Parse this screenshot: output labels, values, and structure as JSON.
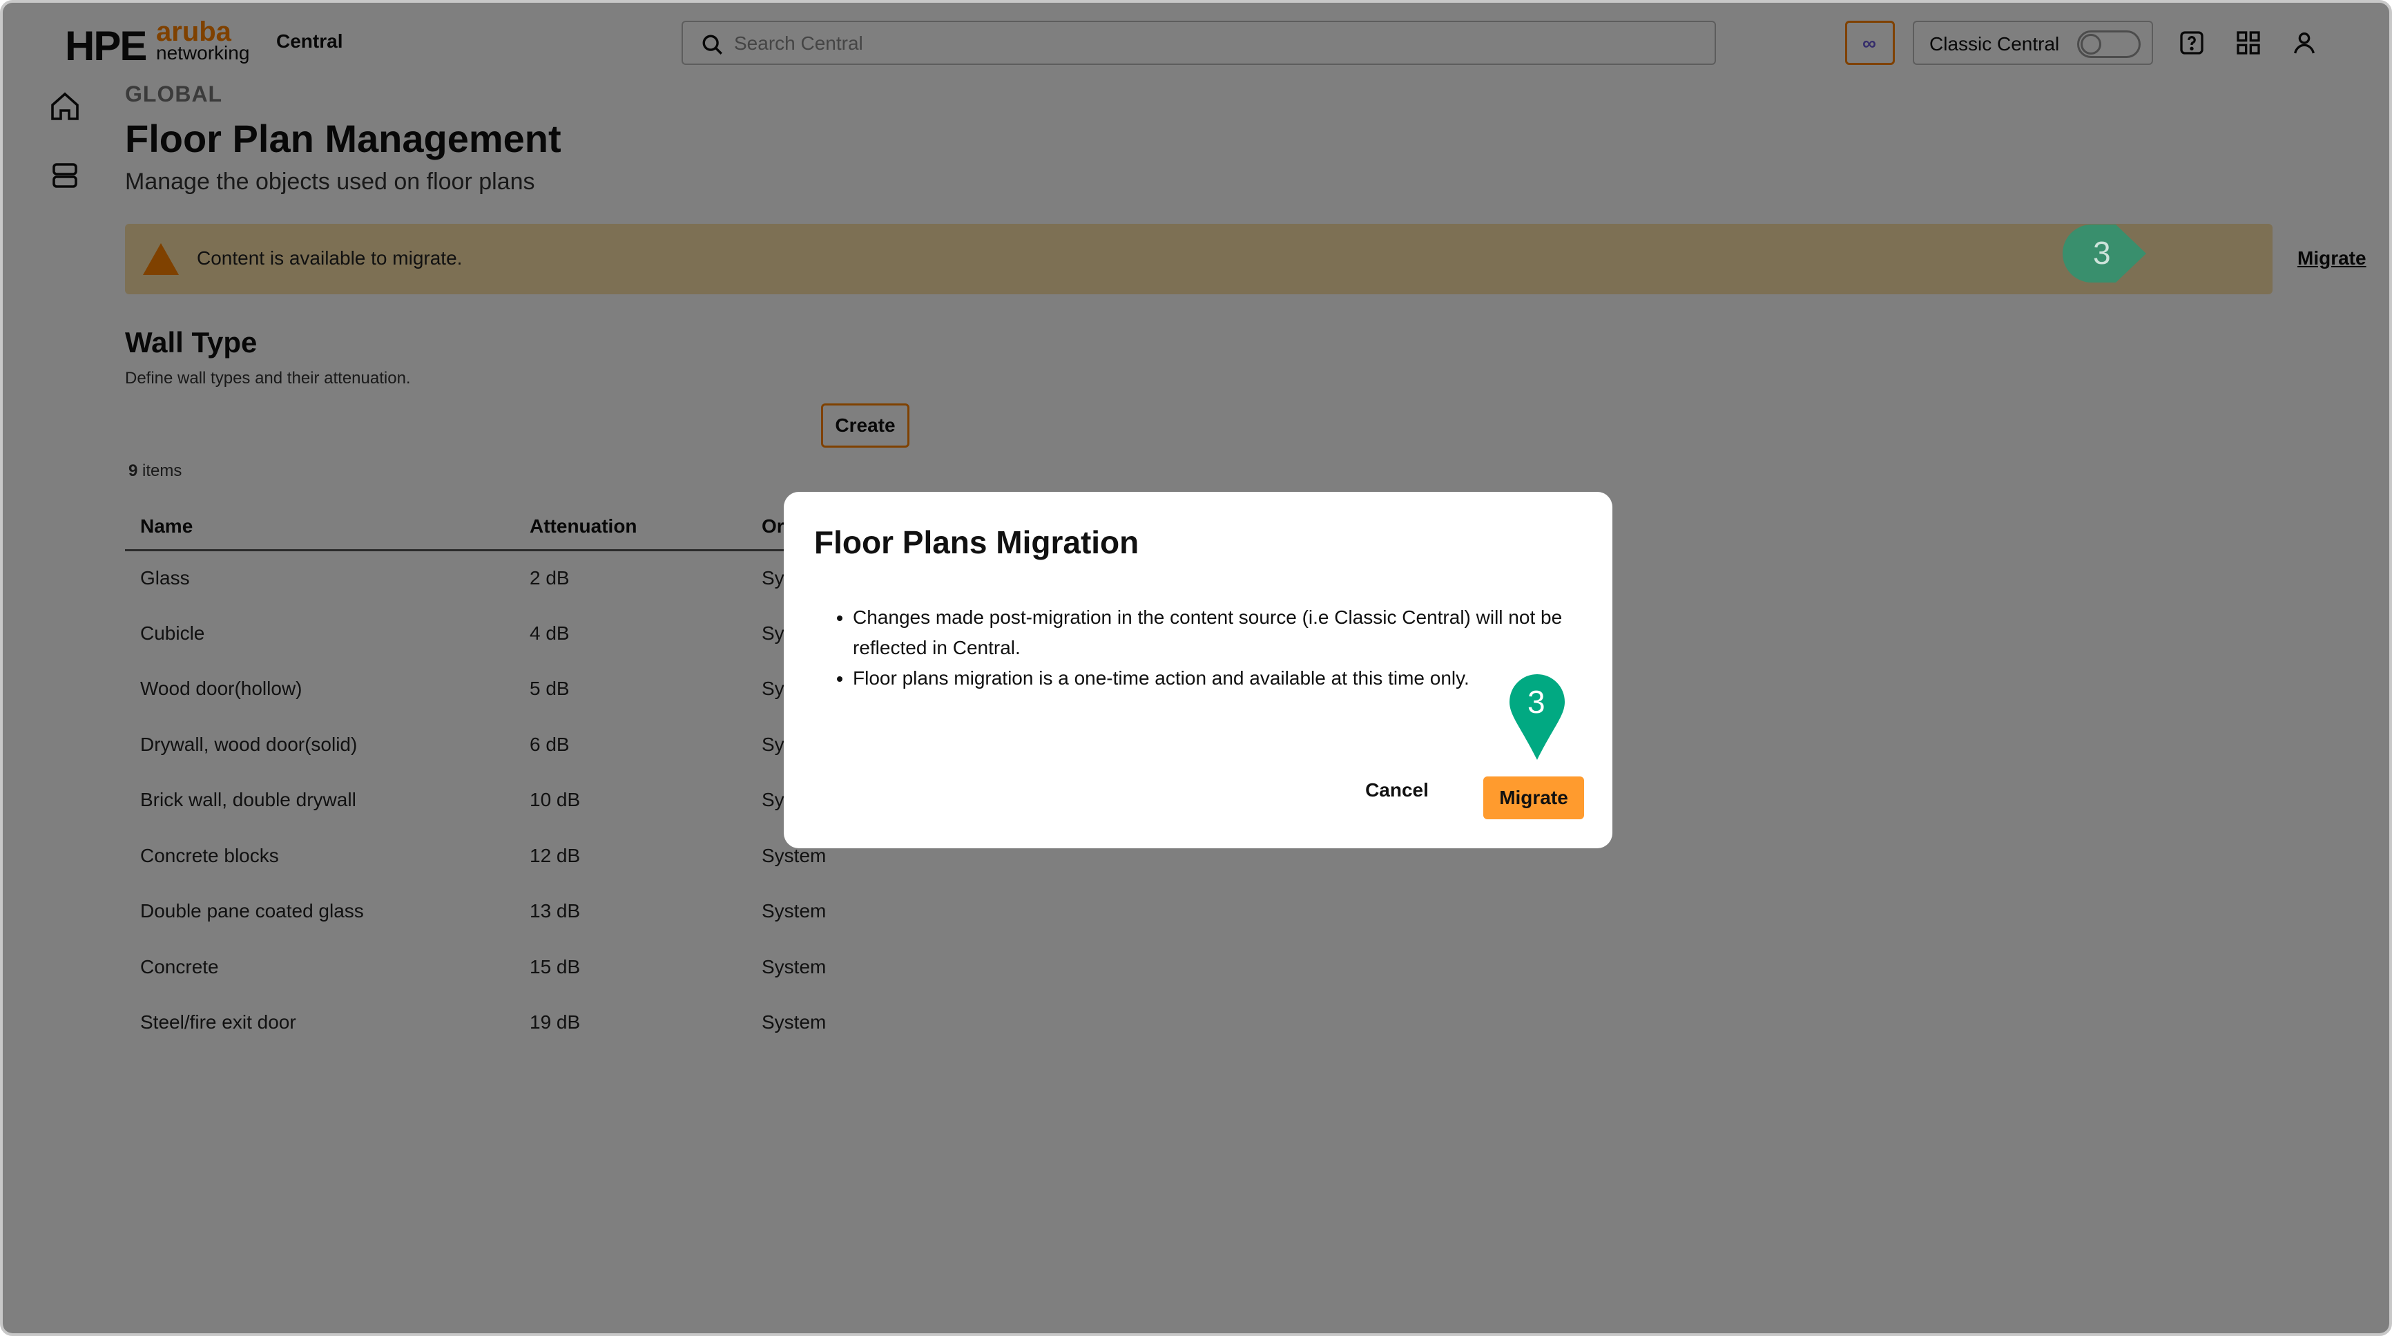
{
  "header": {
    "logo_hpe": "HPE",
    "logo_aruba": "aruba",
    "logo_networking": "networking",
    "app_name": "Central",
    "search_placeholder": "Search Central",
    "classic_toggle_label": "Classic Central",
    "classic_toggle_on": false
  },
  "page": {
    "breadcrumb": "GLOBAL",
    "title": "Floor Plan Management",
    "subtitle": "Manage the objects used on floor plans"
  },
  "banner": {
    "message": "Content is available to migrate.",
    "action_label": "Migrate",
    "callout_step": "3"
  },
  "wall_type": {
    "title": "Wall Type",
    "description": "Define wall types and their attenuation.",
    "create_label": "Create",
    "count": "9",
    "count_suffix": "items",
    "columns": [
      "Name",
      "Attenuation",
      "Origin"
    ],
    "rows": [
      {
        "name": "Glass",
        "attenuation": "2 dB",
        "origin": "System"
      },
      {
        "name": "Cubicle",
        "attenuation": "4 dB",
        "origin": "System"
      },
      {
        "name": "Wood door(hollow)",
        "attenuation": "5 dB",
        "origin": "System"
      },
      {
        "name": "Drywall, wood door(solid)",
        "attenuation": "6 dB",
        "origin": "System"
      },
      {
        "name": "Brick wall, double drywall",
        "attenuation": "10 dB",
        "origin": "System"
      },
      {
        "name": "Concrete blocks",
        "attenuation": "12 dB",
        "origin": "System"
      },
      {
        "name": "Double pane coated glass",
        "attenuation": "13 dB",
        "origin": "System"
      },
      {
        "name": "Concrete",
        "attenuation": "15 dB",
        "origin": "System"
      },
      {
        "name": "Steel/fire exit door",
        "attenuation": "19 dB",
        "origin": "System"
      }
    ]
  },
  "modal": {
    "title": "Floor Plans Migration",
    "bullets": [
      "Changes made post-migration in the content source (i.e Classic Central) will not be reflected in Central.",
      "Floor plans migration is a one-time action and available at this time only."
    ],
    "cancel_label": "Cancel",
    "migrate_label": "Migrate",
    "callout_step": "3"
  },
  "colors": {
    "accent": "#ff8300",
    "callout": "#01a982",
    "banner_bg": "#fbe1a9",
    "overlay": "rgba(0,0,0,0.5)"
  }
}
